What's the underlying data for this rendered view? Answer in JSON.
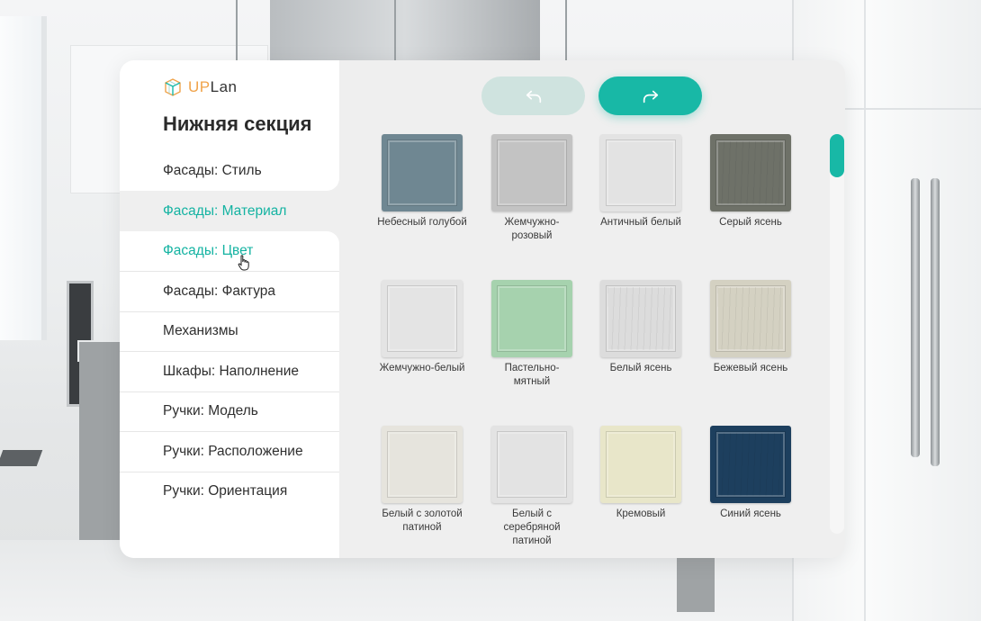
{
  "brand": {
    "u": "UP",
    "rest": "Lan"
  },
  "sidebar": {
    "title": "Нижняя секция",
    "items": [
      {
        "label": "Фасады: Стиль"
      },
      {
        "label": "Фасады: Материал"
      },
      {
        "label": "Фасады: Цвет"
      },
      {
        "label": "Фасады: Фактура"
      },
      {
        "label": "Механизмы"
      },
      {
        "label": "Шкафы: Наполнение"
      },
      {
        "label": "Ручки: Модель"
      },
      {
        "label": "Ручки: Расположение"
      },
      {
        "label": "Ручки: Ориентация"
      }
    ]
  },
  "toolbar": {
    "undo_icon": "undo-arrow-icon",
    "redo_icon": "redo-arrow-icon"
  },
  "colors": {
    "accent": "#18b8a6",
    "accent_light": "#cfe3df",
    "text": "#2b2b2b",
    "logo_orange": "#f0a34a"
  },
  "swatches": [
    {
      "name": "Небесный голубой",
      "color": "#6f8792"
    },
    {
      "name": "Жемчужно-розовый",
      "color": "#c3c3c3"
    },
    {
      "name": "Античный белый",
      "color": "#e3e3e3"
    },
    {
      "name": "Серый ясень",
      "color": "#6e7168",
      "grain": true
    },
    {
      "name": "Жемчужно-белый",
      "color": "#e4e4e4"
    },
    {
      "name": "Пастельно-мятный",
      "color": "#a6d2ae"
    },
    {
      "name": "Белый ясень",
      "color": "#dcdcdc",
      "grain": true
    },
    {
      "name": "Бежевый ясень",
      "color": "#d4d1c2",
      "grain": true
    },
    {
      "name": "Белый с золотой патиной",
      "color": "#e6e4dd"
    },
    {
      "name": "Белый с серебряной патиной",
      "color": "#e3e3e3"
    },
    {
      "name": "Кремовый",
      "color": "#e8e6c9"
    },
    {
      "name": "Синий ясень",
      "color": "#1d3f5e",
      "grain": true
    }
  ]
}
